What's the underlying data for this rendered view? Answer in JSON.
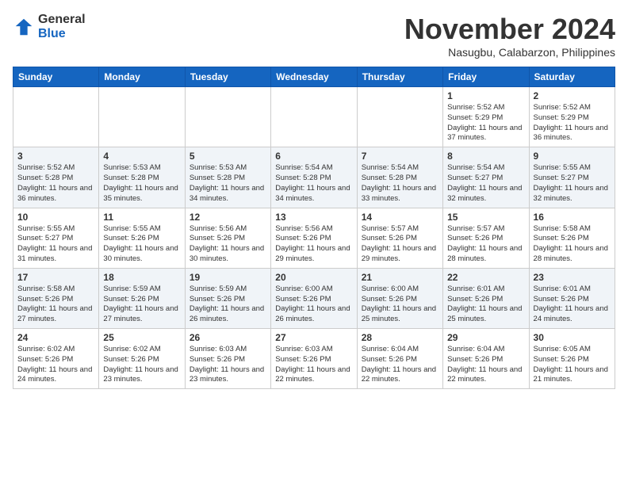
{
  "logo": {
    "general": "General",
    "blue": "Blue"
  },
  "header": {
    "month": "November 2024",
    "location": "Nasugbu, Calabarzon, Philippines"
  },
  "weekdays": [
    "Sunday",
    "Monday",
    "Tuesday",
    "Wednesday",
    "Thursday",
    "Friday",
    "Saturday"
  ],
  "weeks": [
    [
      {
        "day": "",
        "info": ""
      },
      {
        "day": "",
        "info": ""
      },
      {
        "day": "",
        "info": ""
      },
      {
        "day": "",
        "info": ""
      },
      {
        "day": "",
        "info": ""
      },
      {
        "day": "1",
        "info": "Sunrise: 5:52 AM\nSunset: 5:29 PM\nDaylight: 11 hours and 37 minutes."
      },
      {
        "day": "2",
        "info": "Sunrise: 5:52 AM\nSunset: 5:29 PM\nDaylight: 11 hours and 36 minutes."
      }
    ],
    [
      {
        "day": "3",
        "info": "Sunrise: 5:52 AM\nSunset: 5:28 PM\nDaylight: 11 hours and 36 minutes."
      },
      {
        "day": "4",
        "info": "Sunrise: 5:53 AM\nSunset: 5:28 PM\nDaylight: 11 hours and 35 minutes."
      },
      {
        "day": "5",
        "info": "Sunrise: 5:53 AM\nSunset: 5:28 PM\nDaylight: 11 hours and 34 minutes."
      },
      {
        "day": "6",
        "info": "Sunrise: 5:54 AM\nSunset: 5:28 PM\nDaylight: 11 hours and 34 minutes."
      },
      {
        "day": "7",
        "info": "Sunrise: 5:54 AM\nSunset: 5:28 PM\nDaylight: 11 hours and 33 minutes."
      },
      {
        "day": "8",
        "info": "Sunrise: 5:54 AM\nSunset: 5:27 PM\nDaylight: 11 hours and 32 minutes."
      },
      {
        "day": "9",
        "info": "Sunrise: 5:55 AM\nSunset: 5:27 PM\nDaylight: 11 hours and 32 minutes."
      }
    ],
    [
      {
        "day": "10",
        "info": "Sunrise: 5:55 AM\nSunset: 5:27 PM\nDaylight: 11 hours and 31 minutes."
      },
      {
        "day": "11",
        "info": "Sunrise: 5:55 AM\nSunset: 5:26 PM\nDaylight: 11 hours and 30 minutes."
      },
      {
        "day": "12",
        "info": "Sunrise: 5:56 AM\nSunset: 5:26 PM\nDaylight: 11 hours and 30 minutes."
      },
      {
        "day": "13",
        "info": "Sunrise: 5:56 AM\nSunset: 5:26 PM\nDaylight: 11 hours and 29 minutes."
      },
      {
        "day": "14",
        "info": "Sunrise: 5:57 AM\nSunset: 5:26 PM\nDaylight: 11 hours and 29 minutes."
      },
      {
        "day": "15",
        "info": "Sunrise: 5:57 AM\nSunset: 5:26 PM\nDaylight: 11 hours and 28 minutes."
      },
      {
        "day": "16",
        "info": "Sunrise: 5:58 AM\nSunset: 5:26 PM\nDaylight: 11 hours and 28 minutes."
      }
    ],
    [
      {
        "day": "17",
        "info": "Sunrise: 5:58 AM\nSunset: 5:26 PM\nDaylight: 11 hours and 27 minutes."
      },
      {
        "day": "18",
        "info": "Sunrise: 5:59 AM\nSunset: 5:26 PM\nDaylight: 11 hours and 27 minutes."
      },
      {
        "day": "19",
        "info": "Sunrise: 5:59 AM\nSunset: 5:26 PM\nDaylight: 11 hours and 26 minutes."
      },
      {
        "day": "20",
        "info": "Sunrise: 6:00 AM\nSunset: 5:26 PM\nDaylight: 11 hours and 26 minutes."
      },
      {
        "day": "21",
        "info": "Sunrise: 6:00 AM\nSunset: 5:26 PM\nDaylight: 11 hours and 25 minutes."
      },
      {
        "day": "22",
        "info": "Sunrise: 6:01 AM\nSunset: 5:26 PM\nDaylight: 11 hours and 25 minutes."
      },
      {
        "day": "23",
        "info": "Sunrise: 6:01 AM\nSunset: 5:26 PM\nDaylight: 11 hours and 24 minutes."
      }
    ],
    [
      {
        "day": "24",
        "info": "Sunrise: 6:02 AM\nSunset: 5:26 PM\nDaylight: 11 hours and 24 minutes."
      },
      {
        "day": "25",
        "info": "Sunrise: 6:02 AM\nSunset: 5:26 PM\nDaylight: 11 hours and 23 minutes."
      },
      {
        "day": "26",
        "info": "Sunrise: 6:03 AM\nSunset: 5:26 PM\nDaylight: 11 hours and 23 minutes."
      },
      {
        "day": "27",
        "info": "Sunrise: 6:03 AM\nSunset: 5:26 PM\nDaylight: 11 hours and 22 minutes."
      },
      {
        "day": "28",
        "info": "Sunrise: 6:04 AM\nSunset: 5:26 PM\nDaylight: 11 hours and 22 minutes."
      },
      {
        "day": "29",
        "info": "Sunrise: 6:04 AM\nSunset: 5:26 PM\nDaylight: 11 hours and 22 minutes."
      },
      {
        "day": "30",
        "info": "Sunrise: 6:05 AM\nSunset: 5:26 PM\nDaylight: 11 hours and 21 minutes."
      }
    ]
  ]
}
